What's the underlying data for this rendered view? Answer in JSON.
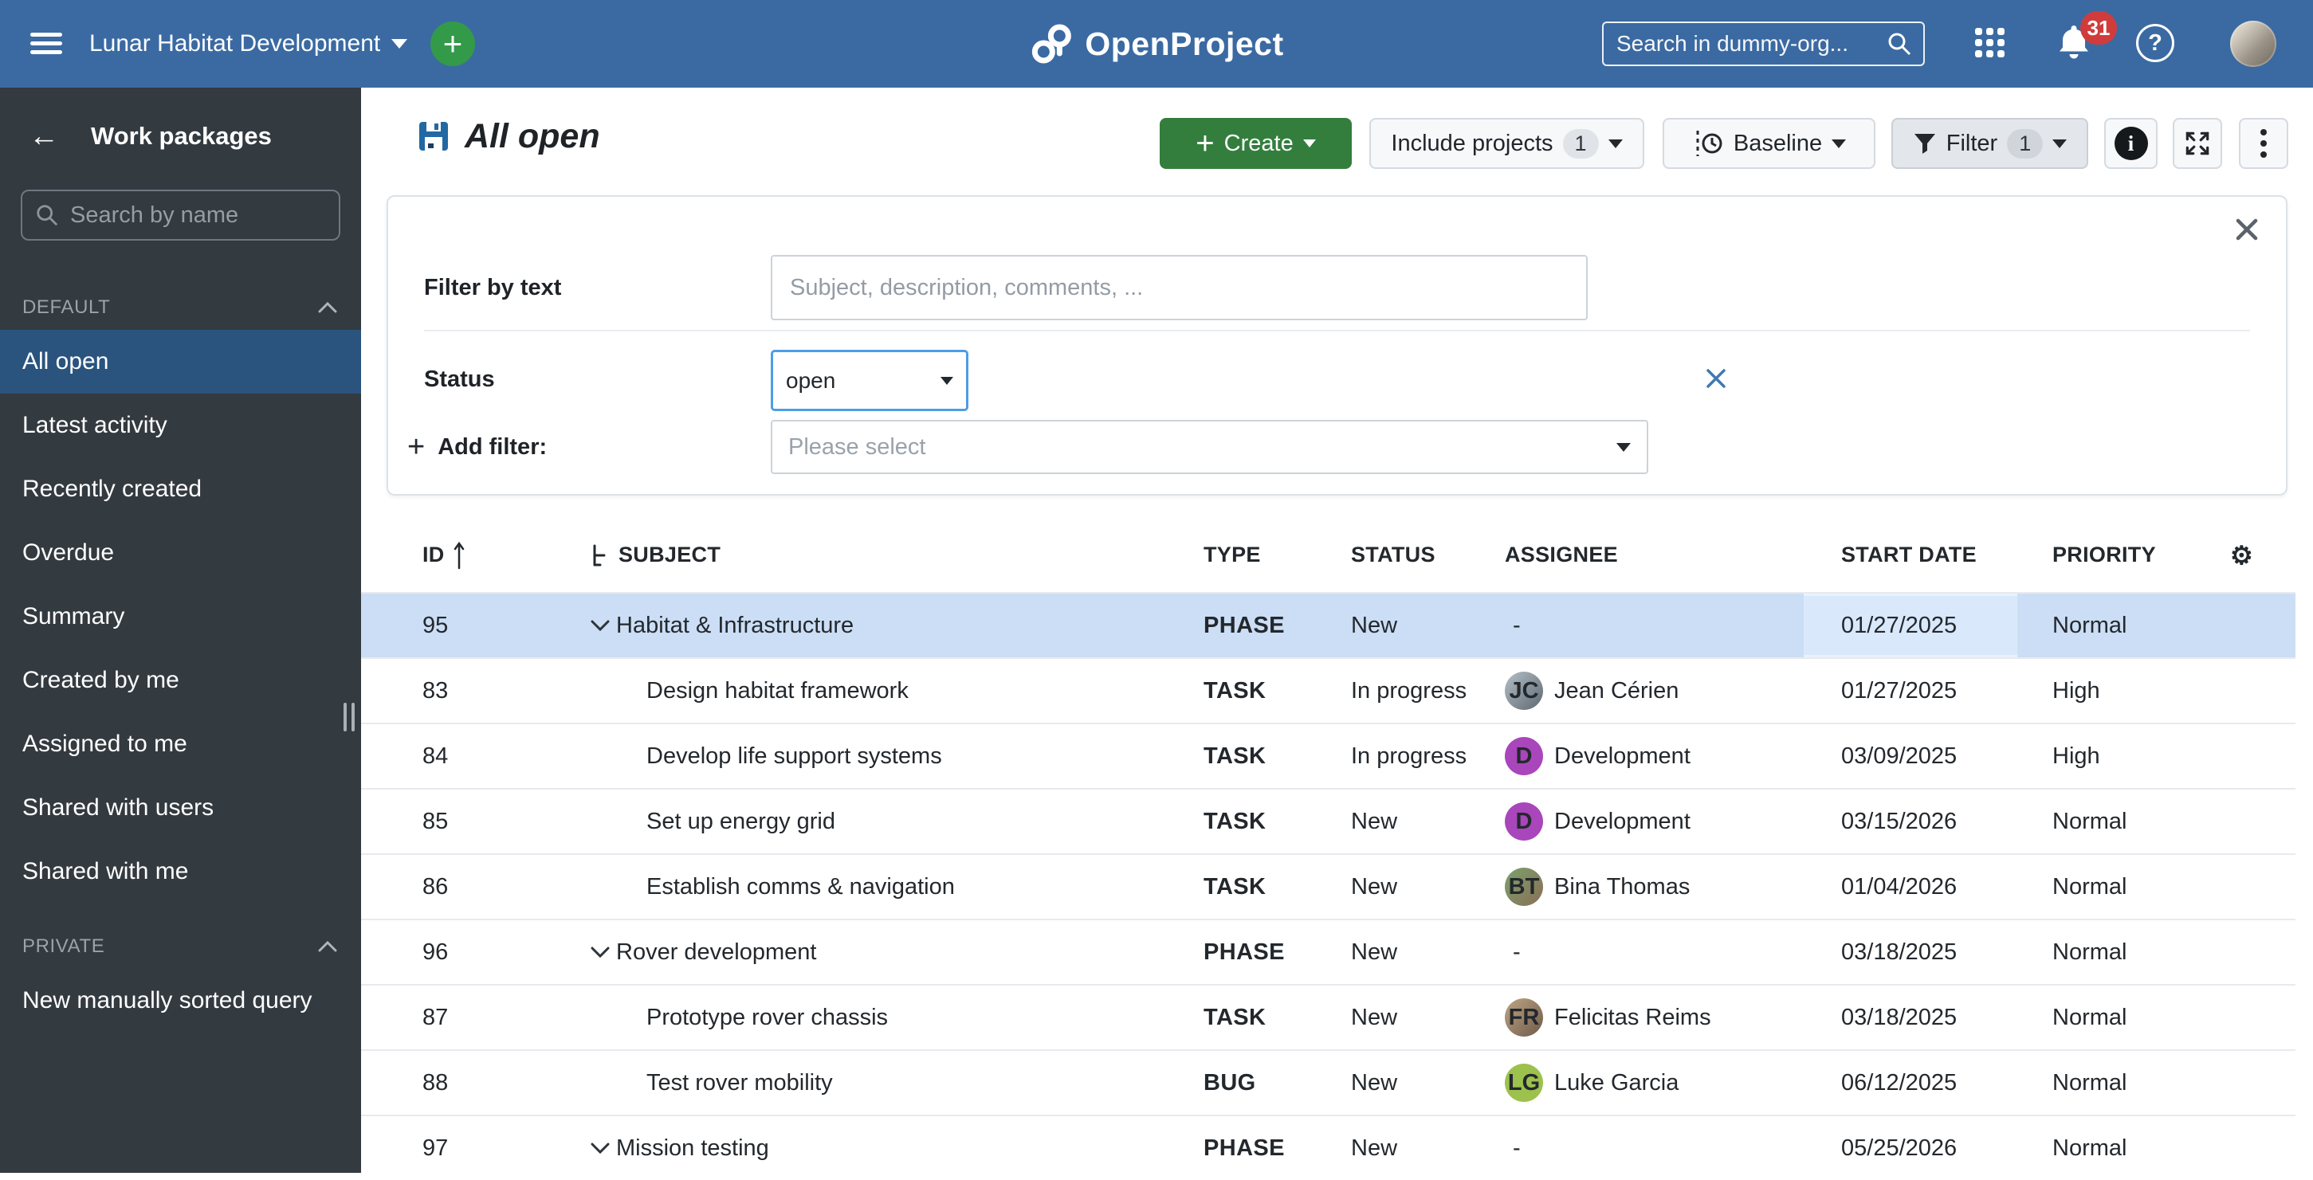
{
  "topbar": {
    "project": "Lunar Habitat Development",
    "logo": "OpenProject",
    "search_placeholder": "Search in dummy-org...",
    "notification_count": "31",
    "help_label": "?"
  },
  "sidebar": {
    "title": "Work packages",
    "search_placeholder": "Search by name",
    "sections": [
      {
        "label": "DEFAULT",
        "items": [
          "All open",
          "Latest activity",
          "Recently created",
          "Overdue",
          "Summary",
          "Created by me",
          "Assigned to me",
          "Shared with users",
          "Shared with me"
        ]
      },
      {
        "label": "PRIVATE",
        "items": [
          "New manually sorted query"
        ]
      }
    ]
  },
  "page": {
    "title": "All open"
  },
  "toolbar": {
    "create": "Create",
    "include_projects": "Include projects",
    "include_count": "1",
    "baseline": "Baseline",
    "filter": "Filter",
    "filter_count": "1"
  },
  "filter_panel": {
    "text_label": "Filter by text",
    "text_placeholder": "Subject, description, comments, ...",
    "status_label": "Status",
    "status_value": "open",
    "add_filter_label": "Add filter:",
    "add_filter_plus": "+",
    "add_filter_placeholder": "Please select"
  },
  "table": {
    "columns": {
      "id": "ID",
      "subject": "SUBJECT",
      "type": "TYPE",
      "status": "STATUS",
      "assignee": "ASSIGNEE",
      "start_date": "START DATE",
      "priority": "PRIORITY"
    },
    "rows": [
      {
        "id": "95",
        "subject": "Habitat & Infrastructure",
        "type": "PHASE",
        "status": "New",
        "assignee_dash": "-",
        "start_date": "01/27/2025",
        "priority": "Normal"
      },
      {
        "id": "83",
        "subject": "Design habitat framework",
        "type": "TASK",
        "status": "In progress",
        "assignee": {
          "name": "Jean Cérien",
          "initials": "JC"
        },
        "start_date": "01/27/2025",
        "priority": "High"
      },
      {
        "id": "84",
        "subject": "Develop life support systems",
        "type": "TASK",
        "status": "In progress",
        "assignee": {
          "name": "Development",
          "initials": "D"
        },
        "start_date": "03/09/2025",
        "priority": "High"
      },
      {
        "id": "85",
        "subject": "Set up energy grid",
        "type": "TASK",
        "status": "New",
        "assignee": {
          "name": "Development",
          "initials": "D"
        },
        "start_date": "03/15/2026",
        "priority": "Normal"
      },
      {
        "id": "86",
        "subject": "Establish comms & navigation",
        "type": "TASK",
        "status": "New",
        "assignee": {
          "name": "Bina Thomas",
          "initials": "BT"
        },
        "start_date": "01/04/2026",
        "priority": "Normal"
      },
      {
        "id": "96",
        "subject": "Rover development",
        "type": "PHASE",
        "status": "New",
        "assignee_dash": "-",
        "start_date": "03/18/2025",
        "priority": "Normal"
      },
      {
        "id": "87",
        "subject": "Prototype rover chassis",
        "type": "TASK",
        "status": "New",
        "assignee": {
          "name": "Felicitas Reims",
          "initials": "FR"
        },
        "start_date": "03/18/2025",
        "priority": "Normal"
      },
      {
        "id": "88",
        "subject": "Test rover mobility",
        "type": "BUG",
        "status": "New",
        "assignee": {
          "name": "Luke Garcia",
          "initials": "LG"
        },
        "start_date": "06/12/2025",
        "priority": "Normal"
      },
      {
        "id": "97",
        "subject": "Mission testing",
        "type": "PHASE",
        "status": "New",
        "assignee_dash": "-",
        "start_date": "05/25/2026",
        "priority": "Normal"
      }
    ]
  },
  "colors": {
    "topbar": "#3b6aa2",
    "link": "#2268a3",
    "type_phase": "#e0772b",
    "type_task": "#17659f",
    "type_bug": "#cc3333",
    "create_button": "#337e3d",
    "selected_row": "#cbdef5",
    "badge_red": "#d03c3c",
    "avatar_purple": "#a946bb",
    "avatar_green": "#9cc14d",
    "sidebar_bg": "#333a40",
    "sidebar_active": "#2a547e"
  }
}
